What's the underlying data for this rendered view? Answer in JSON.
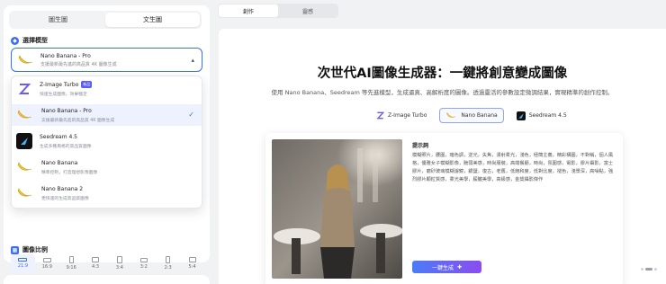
{
  "left": {
    "mode_tabs": [
      {
        "label": "圖生圖",
        "active": false
      },
      {
        "label": "文生圖",
        "active": true
      }
    ],
    "model_section_label": "選擇模型",
    "selected_model": {
      "title": "Nano Banana - Pro",
      "subtitle": "支援最新最先進的高品質 4K 圖像生成"
    },
    "model_options": [
      {
        "title": "Z-Image Turbo",
        "badge": "新品",
        "subtitle": "快速生成圖像，效果穩定",
        "logo": "z-image-logo",
        "selected": false
      },
      {
        "title": "Nano Banana - Pro",
        "subtitle": "支援最新最先進的高品質 4K 圖像生成",
        "logo": "banana-logo",
        "selected": true
      },
      {
        "title": "Seedream 4.5",
        "subtitle": "生成多種風格的高品質圖像",
        "logo": "seedream-logo",
        "selected": false
      },
      {
        "title": "Nano Banana",
        "subtitle": "精準控制，打造理想影像圖像",
        "logo": "banana-logo",
        "selected": false
      },
      {
        "title": "Nano Banana 2",
        "subtitle": "更快速的生成高品質圖像",
        "logo": "banana-logo",
        "selected": false
      }
    ],
    "ratio_section_label": "圖像比例",
    "ratios": [
      {
        "label": "21:9",
        "active": true
      },
      {
        "label": "16:9",
        "active": false
      },
      {
        "label": "9:16",
        "active": false
      },
      {
        "label": "4:3",
        "active": false
      },
      {
        "label": "3:4",
        "active": false
      },
      {
        "label": "3:2",
        "active": false
      },
      {
        "label": "2:3",
        "active": false
      },
      {
        "label": "5:4",
        "active": false
      }
    ]
  },
  "right": {
    "top_tabs": [
      {
        "label": "創作",
        "active": true
      },
      {
        "label": "靈感",
        "active": false
      }
    ],
    "hero_title": "次世代AI圖像生成器：一鍵將創意變成圖像",
    "hero_subtitle": "使用 Nano Banana、Seedream 等先進模型，生成逼真、高解析度的圖像。透過靈活的參數設定微調結果，實現精準的創作控制。",
    "model_pills": [
      {
        "label": "Z-Image Turbo",
        "active": false,
        "logo": "z-image-logo"
      },
      {
        "label": "Nano Banana",
        "active": true,
        "logo": "banana-logo"
      },
      {
        "label": "Seedream 4.5",
        "active": false,
        "logo": "seedream-logo"
      }
    ],
    "prompt_title": "提示詞",
    "prompt_text": "模糊照片，腰圍，暗色調，逆光，失焦，漫射柔光，淺色，極簡主義，精彩構圖，不對稱，個人風格，優雅女子模糊影像，脆弱美感，時尚服裝，高端餐廳，時尚，氛圍感，電影，膠片攝影，富士膠片，磨砂玻璃模糊濾鏡，銀鹽，復古，老舊，低飽和度，低對比度，褪色，淺景深，高噪點，強烈膠片顆粒質感，柔光美學，朦朧美學，高級感，金獎攝影傑作",
    "generate_button": "一鍵生成",
    "carousel": {
      "active_index": 0,
      "count": 3
    }
  },
  "colors": {
    "accent": "#3b6ef6",
    "gradient_start": "#4a7cf7",
    "gradient_end": "#8a4df0"
  }
}
